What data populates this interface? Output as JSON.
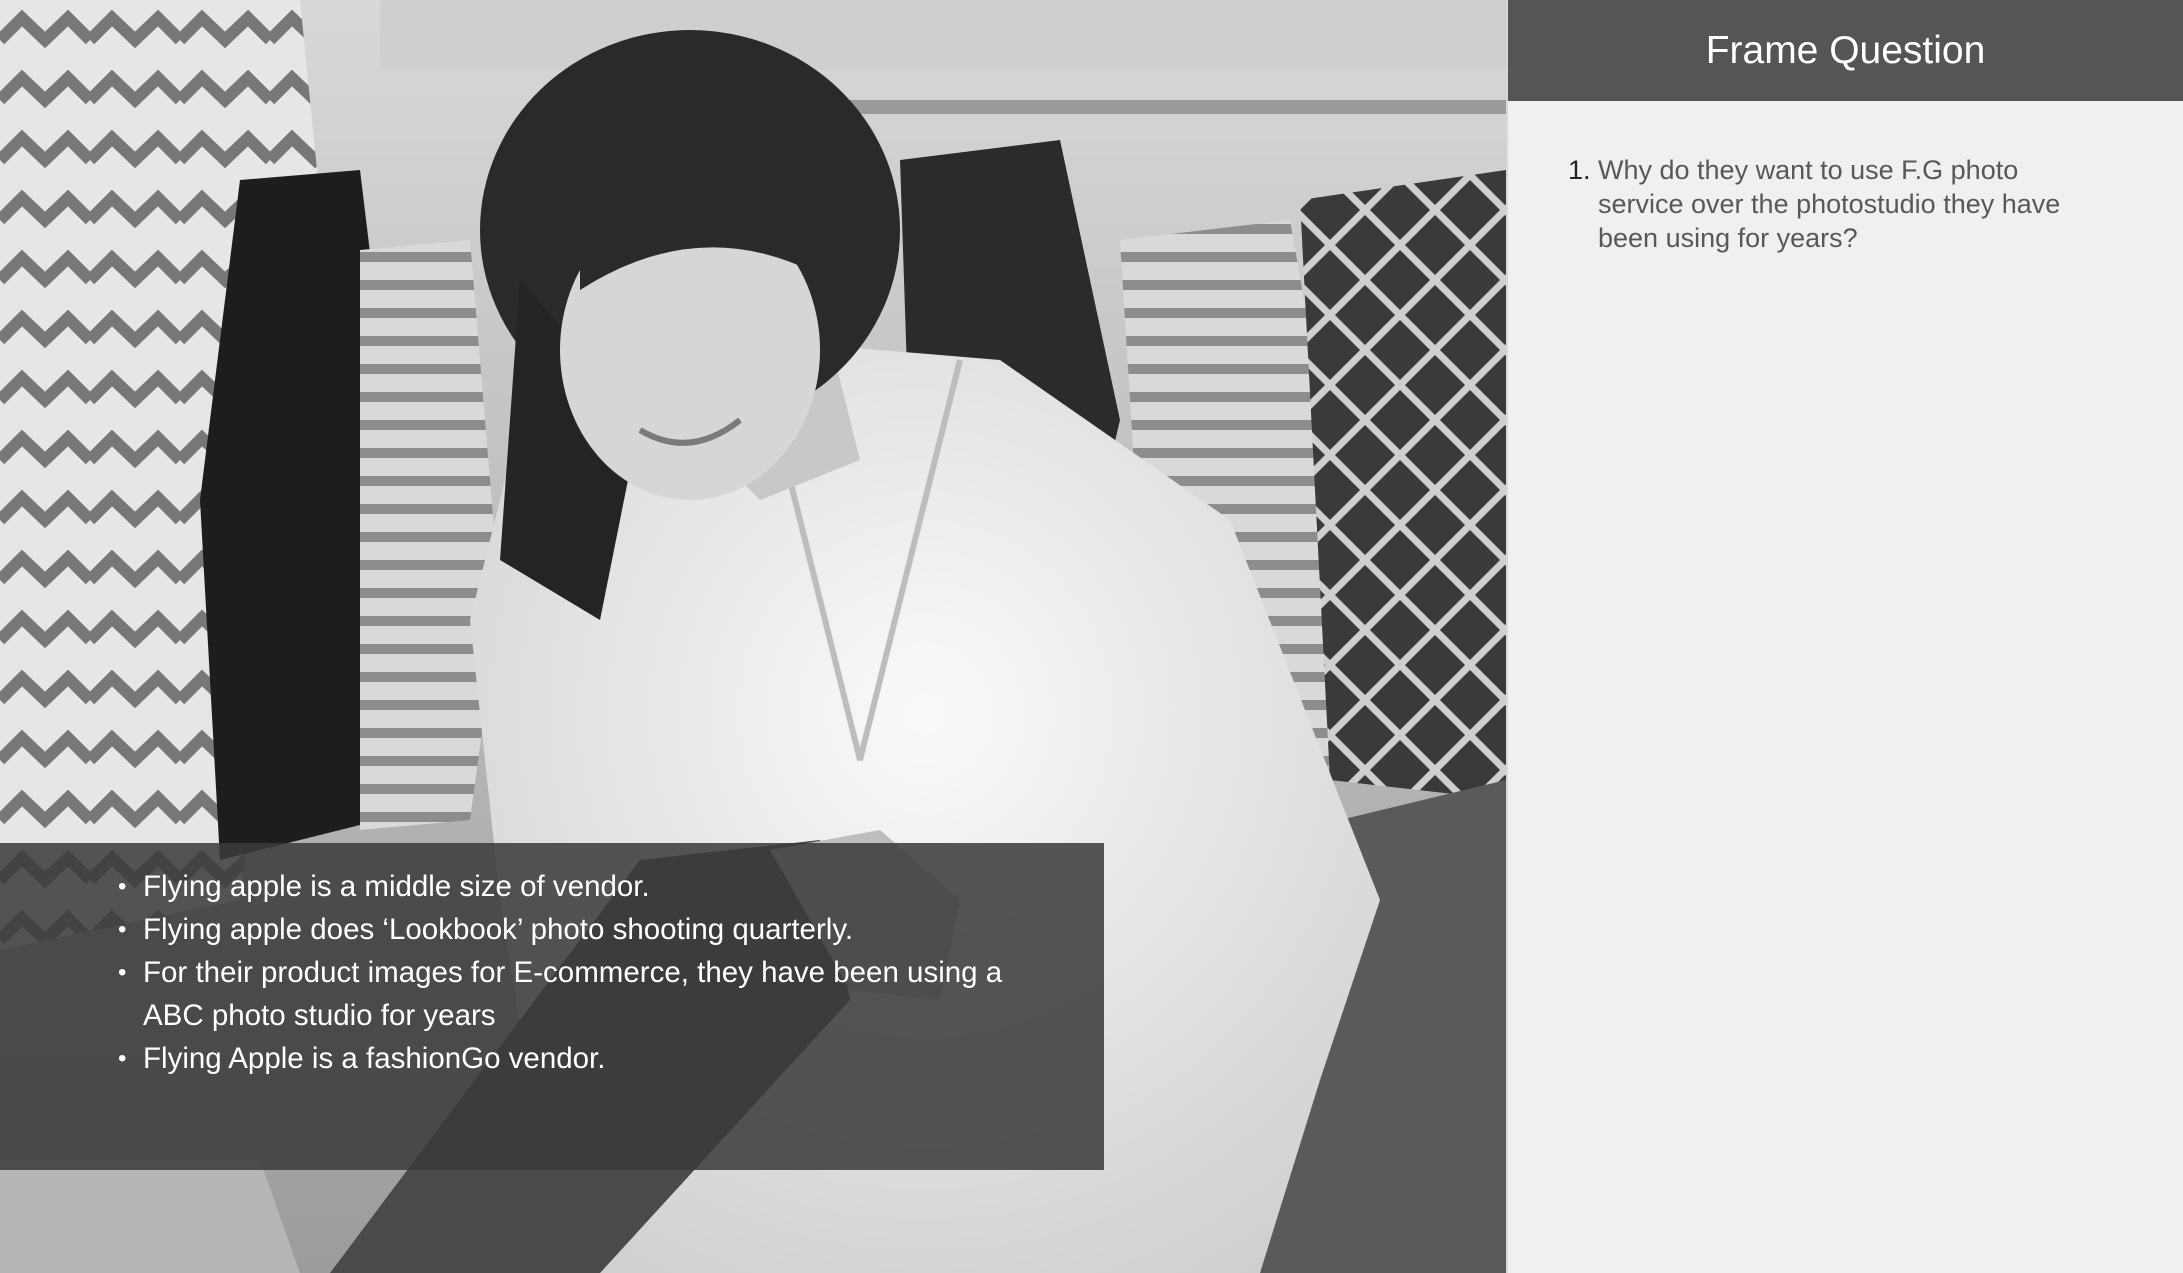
{
  "panel": {
    "title": "Frame Question",
    "questions": [
      {
        "number": "1.",
        "text": "Why do they want to use F.G photo service over the photostudio they have been using for years?"
      }
    ]
  },
  "overlay": {
    "bullets": [
      "Flying apple is a middle size of vendor.",
      "Flying apple does ‘Lookbook’ photo shooting quarterly.",
      "For their product images for E-commerce, they have been using a ABC photo studio for years",
      "Flying Apple is a fashionGo vendor."
    ]
  },
  "colors": {
    "panel_header": "#555555",
    "panel_background": "#f0f0f0",
    "overlay": "#3a3a3a"
  }
}
